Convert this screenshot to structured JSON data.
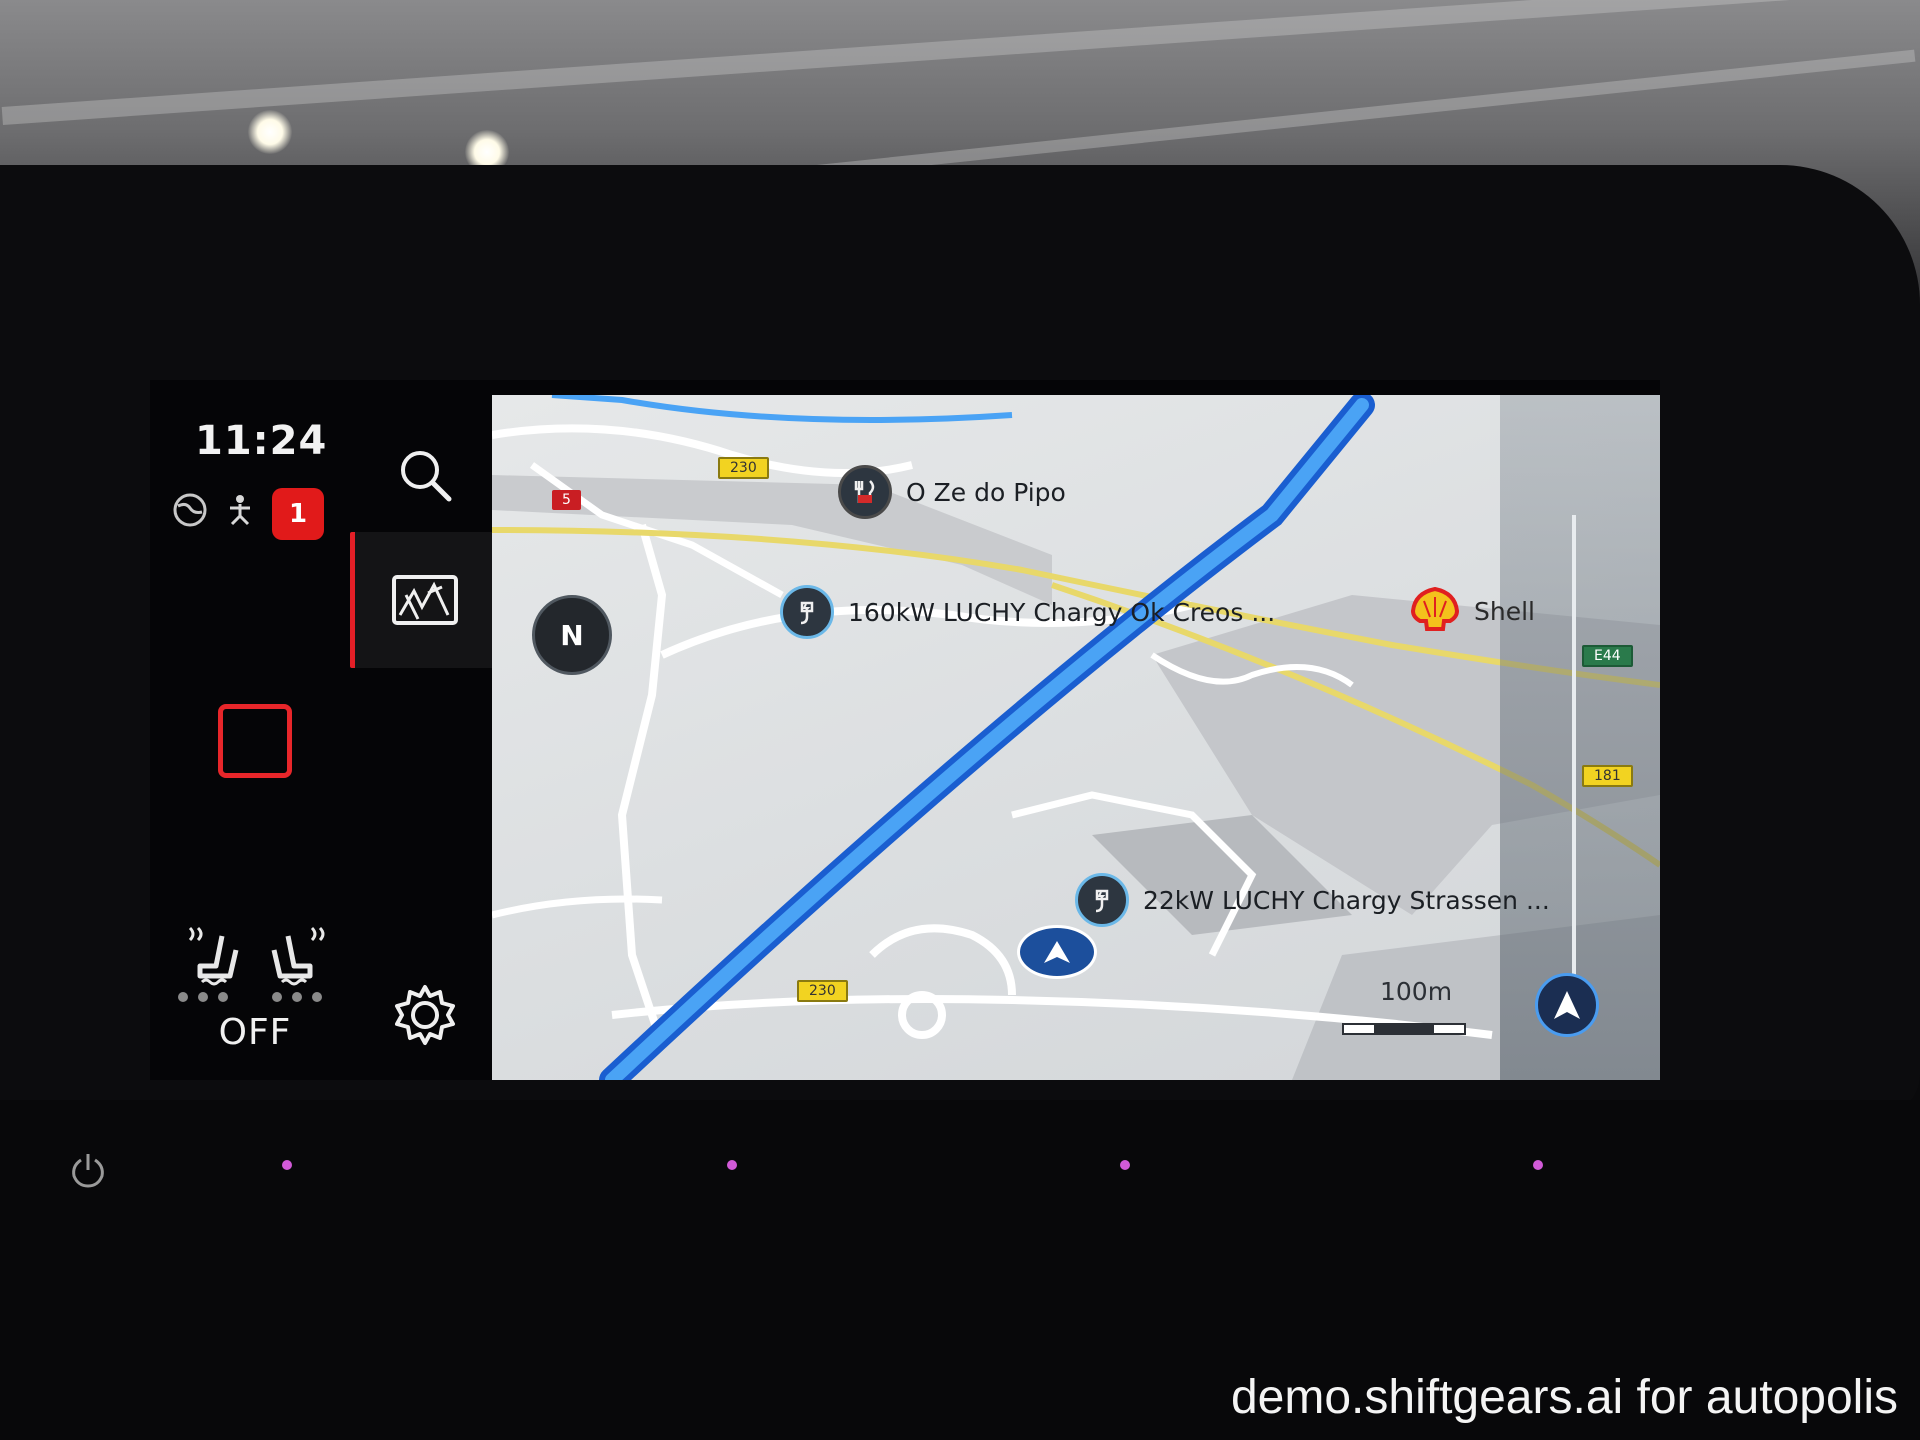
{
  "status": {
    "time": "11:24",
    "notification_count": "1",
    "fan_status": "OFF"
  },
  "map": {
    "pois": [
      {
        "label": "O Ze do Pipo",
        "icon": "restaurant-icon"
      },
      {
        "label": "160kW LUCHY Chargy Ok Creos ...",
        "icon": "ev-charging-icon"
      },
      {
        "label": "Shell",
        "icon": "shell-fuel-icon"
      },
      {
        "label": "22kW LUCHY Chargy Strassen ...",
        "icon": "ev-charging-icon"
      }
    ],
    "road_shields": [
      "230",
      "5",
      "230",
      "E44",
      "181"
    ],
    "scale": "100m",
    "compass": "N"
  },
  "watermark": "demo.shiftgears.ai for autopolis",
  "colors": {
    "accent_red": "#e41f27",
    "route_blue": "#2f7ff0",
    "map_land": "#e0e2e3",
    "road_white": "#ffffff",
    "road_yellow": "#f2d321"
  }
}
